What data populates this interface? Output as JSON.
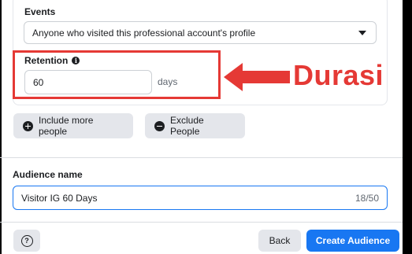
{
  "events": {
    "label": "Events",
    "selected": "Anyone who visited this professional account's profile"
  },
  "retention": {
    "label": "Retention",
    "value": "60",
    "unit": "days"
  },
  "annotation": {
    "text": "Durasi",
    "color": "#e53935"
  },
  "actions": {
    "include_label": "Include more people",
    "exclude_label": "Exclude People"
  },
  "audience": {
    "label": "Audience name",
    "value": "Visitor IG 60 Days",
    "counter": "18/50"
  },
  "footer": {
    "back_label": "Back",
    "create_label": "Create Audience"
  },
  "colors": {
    "primary": "#1877f2",
    "secondary_button": "#e4e6eb",
    "highlight": "#e53935"
  }
}
